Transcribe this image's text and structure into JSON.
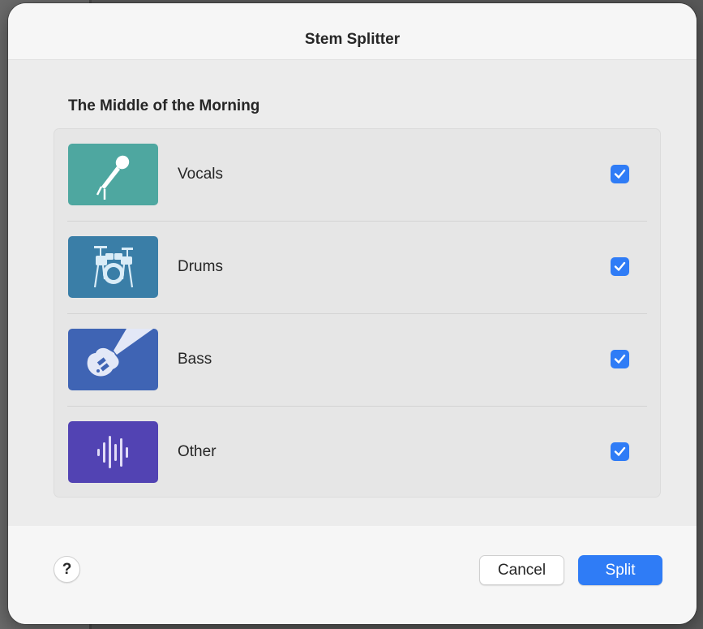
{
  "dialog": {
    "title": "Stem Splitter",
    "track_title": "The Middle of the Morning"
  },
  "stems": [
    {
      "label": "Vocals",
      "icon": "microphone-icon",
      "color": "#4ea7a0",
      "checked": true
    },
    {
      "label": "Drums",
      "icon": "drum-kit-icon",
      "color": "#3a7ea7",
      "checked": true
    },
    {
      "label": "Bass",
      "icon": "bass-guitar-icon",
      "color": "#3f64b4",
      "checked": true
    },
    {
      "label": "Other",
      "icon": "waveform-icon",
      "color": "#5243b3",
      "checked": true
    }
  ],
  "footer": {
    "help_label": "?",
    "cancel_label": "Cancel",
    "split_label": "Split"
  },
  "colors": {
    "accent": "#2f7cf6"
  }
}
